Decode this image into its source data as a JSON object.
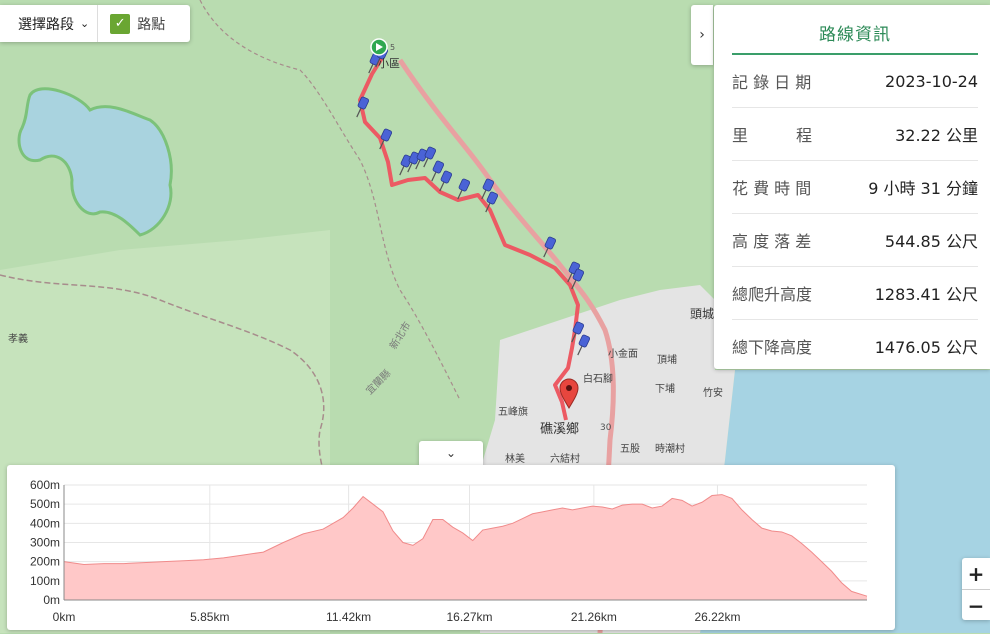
{
  "segment_control": {
    "select_label": "選擇路段",
    "waypoint_label": "路點",
    "waypoint_checked": true
  },
  "info_panel": {
    "title": "路線資訊",
    "rows": [
      {
        "label": "記 錄 日 期",
        "value": "2023-10-24"
      },
      {
        "label": "里　　　程",
        "value": "32.22 公里"
      },
      {
        "label": "花 費 時 間",
        "value": "9 小時 31 分鐘"
      },
      {
        "label": "高 度 落 差",
        "value": "544.85 公尺"
      },
      {
        "label": "總爬升高度",
        "value": "1283.41 公尺"
      },
      {
        "label": "總下降高度",
        "value": "1476.05 公尺"
      }
    ]
  },
  "map_labels": {
    "xinbei": "新北市",
    "yilan": "宜蘭縣",
    "jiaoxi": "礁溪鄉",
    "wufengqi": "五峰旗",
    "xiaojinmian": "小金面",
    "baishijiao": "白石腳",
    "dingpu": "頂埔",
    "xiapu": "下埔",
    "zhuan": "竹安",
    "toucheng": "頭城",
    "liujiecun": "六結村",
    "linmei": "林美",
    "wugu": "五股",
    "shichaocun": "時潮村",
    "jianyi": "孝義",
    "road30": "30",
    "road5": "5",
    "start_area": "小區"
  },
  "colors": {
    "route": "#ec5a63",
    "accent_green": "#2c8a57",
    "elevation_fill": "#ffc8c8",
    "elevation_line": "#f08b8b",
    "map_forest": "#b9dcb0",
    "map_water": "#a9d3df",
    "map_urban": "#e4e4e4",
    "map_sea": "#a6d3e3"
  },
  "icons": {
    "start": "start-flag-icon",
    "end": "end-marker-icon",
    "waypoint": "pushpin-icon",
    "panel_toggle": "chevron-right-icon",
    "elevation_toggle": "chevron-down-icon"
  },
  "zoom": {
    "in": "+",
    "out": "−"
  },
  "chart_data": {
    "type": "area",
    "title": "",
    "xlabel": "",
    "ylabel": "",
    "x_unit": "km",
    "y_unit": "m",
    "xlim": [
      0,
      32.22
    ],
    "ylim": [
      0,
      600
    ],
    "y_ticks": [
      "0m",
      "100m",
      "200m",
      "300m",
      "400m",
      "500m",
      "600m"
    ],
    "y_tick_values": [
      0,
      100,
      200,
      300,
      400,
      500,
      600
    ],
    "x_ticks": [
      "0km",
      "5.85km",
      "11.42km",
      "16.27km",
      "21.26km",
      "26.22km"
    ],
    "x_tick_values": [
      0,
      5.85,
      11.42,
      16.27,
      21.26,
      26.22
    ],
    "grid": true,
    "series": [
      {
        "x": [
          0,
          0.8,
          1.6,
          2.4,
          3.2,
          4.0,
          4.8,
          5.6,
          6.4,
          7.2,
          8.0,
          8.8,
          9.6,
          10.4,
          11.2,
          11.6,
          12.0,
          12.4,
          12.8,
          13.2,
          13.6,
          14.0,
          14.4,
          14.8,
          15.2,
          15.6,
          16.0,
          16.4,
          16.8,
          17.2,
          17.6,
          18.0,
          18.4,
          18.8,
          19.2,
          19.6,
          20.0,
          20.4,
          20.8,
          21.2,
          21.6,
          22.0,
          22.4,
          22.8,
          23.2,
          23.6,
          24.0,
          24.4,
          24.8,
          25.2,
          25.6,
          26.0,
          26.4,
          26.8,
          27.2,
          27.6,
          28.0,
          28.4,
          28.8,
          29.2,
          29.6,
          30.0,
          30.4,
          30.8,
          31.2,
          31.6,
          32.22
        ],
        "y": [
          200,
          185,
          190,
          190,
          195,
          200,
          205,
          210,
          220,
          235,
          250,
          300,
          345,
          370,
          430,
          480,
          540,
          500,
          460,
          360,
          300,
          285,
          320,
          420,
          420,
          380,
          350,
          310,
          365,
          375,
          385,
          400,
          425,
          450,
          460,
          470,
          480,
          470,
          480,
          490,
          485,
          475,
          495,
          500,
          500,
          480,
          490,
          530,
          520,
          490,
          510,
          545,
          550,
          530,
          470,
          420,
          375,
          360,
          355,
          335,
          295,
          250,
          200,
          150,
          90,
          45,
          20
        ]
      }
    ]
  }
}
